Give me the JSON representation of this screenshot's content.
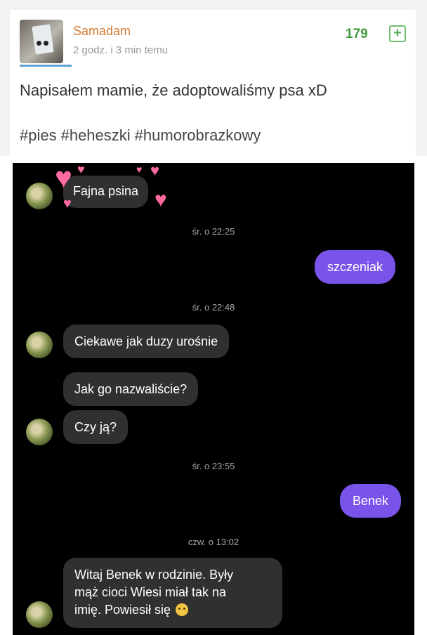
{
  "post": {
    "username": "Samadam",
    "time": "2 godz. i 3 min temu",
    "votes": "179",
    "plus_icon_glyph": "+",
    "text": "Napisałem mamie, że adoptowaliśmy psa xD",
    "tags": [
      "#pies",
      "#heheszki",
      "#humorobrazkowy"
    ]
  },
  "chat": {
    "messages": {
      "m1": "Fajna psina",
      "stamp1": "śr. o 22:25",
      "m2": "szczeniak",
      "stamp2": "śr. o 22:48",
      "m3": "Ciekawe jak duzy urośnie",
      "m4": "Jak go nazwaliście?",
      "m5": "Czy ją?",
      "stamp3": "śr. o 23:55",
      "m6": "Benek",
      "stamp4": "czw. o 13:02",
      "m7_line1": "Witaj Benek w rodzinie.  Były",
      "m7_line2": "mąż cioci Wiesi miał tak na",
      "m7_line3": "imię. Powiesił się"
    },
    "heart_glyph": "♥",
    "colors": {
      "background": "#000000",
      "incoming_bubble": "#303030",
      "outgoing_bubble": "#7a54ea",
      "heart": "#ff6aa2"
    }
  }
}
